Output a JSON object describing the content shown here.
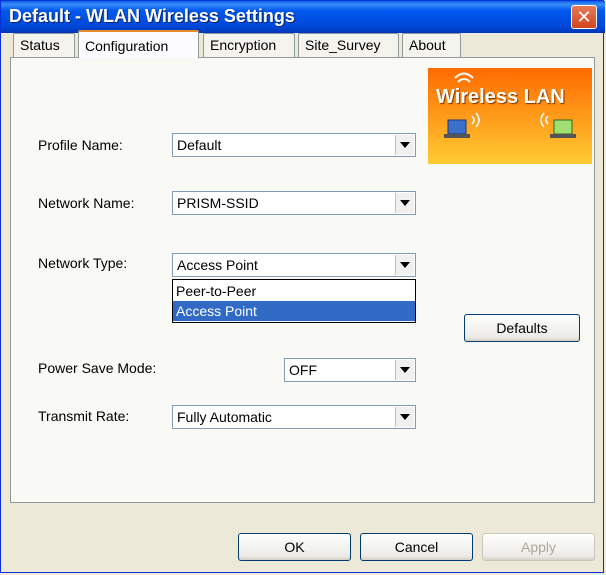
{
  "window": {
    "title": "Default - WLAN Wireless Settings"
  },
  "tabs": [
    {
      "label": "Status"
    },
    {
      "label": "Configuration"
    },
    {
      "label": "Encryption"
    },
    {
      "label": "Site_Survey"
    },
    {
      "label": "About"
    }
  ],
  "logo": {
    "text": "Wireless LAN"
  },
  "form": {
    "profile_name": {
      "label": "Profile Name:",
      "value": "Default"
    },
    "network_name": {
      "label": "Network Name:",
      "value": "PRISM-SSID"
    },
    "network_type": {
      "label": "Network Type:",
      "value": "Access Point",
      "options": [
        "Peer-to-Peer",
        "Access Point"
      ],
      "selected_option": "Access Point"
    },
    "power_save_mode": {
      "label": "Power Save Mode:",
      "value": "OFF"
    },
    "transmit_rate": {
      "label": "Transmit Rate:",
      "value": "Fully Automatic"
    }
  },
  "buttons": {
    "defaults": "Defaults",
    "ok": "OK",
    "cancel": "Cancel",
    "apply": "Apply"
  },
  "colors": {
    "titlebar": "#0054e3",
    "selection": "#316ac5",
    "tab_accent": "#e68b2c"
  }
}
